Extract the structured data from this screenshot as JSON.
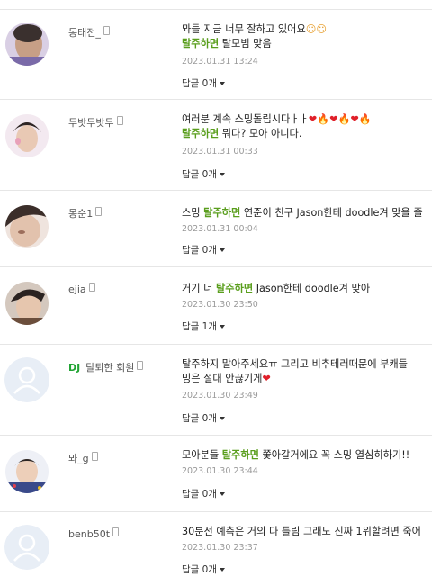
{
  "comments": [
    {
      "nick": "동태전_",
      "line1": "뫄들 지금 너무 잘하고 있어요",
      "emoji1": "☺☺",
      "hl": "탈주하면",
      "line2": "탈모빔 맞음",
      "date": "2023.01.31 13:24",
      "reply": "답글 0개"
    },
    {
      "nick": "두밧두밧두",
      "line1": "여러분 계속 스밍돌립시다ㅏㅏ",
      "emoji1": "❤🔥❤🔥❤🔥",
      "hl": "탈주하면",
      "line2": "뭐다? 모아 아니다.",
      "date": "2023.01.31 00:33",
      "reply": "답글 0개"
    },
    {
      "nick": "몽순1",
      "pre": "스밍 ",
      "hl": "탈주하면",
      "post": " 연준이 친구 Jason한테 doodle겨 맞을 줄",
      "date": "2023.01.31 00:04",
      "reply": "답글 0개"
    },
    {
      "nick": "ejia",
      "pre": "거기 너 ",
      "hl": "탈주하면",
      "post": " Jason한테 doodle겨 맞아",
      "date": "2023.01.30 23:50",
      "reply": "답글 1개"
    },
    {
      "badge": "DJ",
      "nick": "탈퇴한 회원",
      "line1": "탈주하지 말아주세요ㅠ 그리고 비추테러때문에 부캐들",
      "line2": "밍은 절대 안끊기게",
      "emoji2": "❤",
      "date": "2023.01.30 23:49",
      "reply": "답글 0개"
    },
    {
      "nick": "뫄_g",
      "pre": "모아분들 ",
      "hl": "탈주하면",
      "post": " 쫓아갈거에요 꼭 스밍 열심히하기!!",
      "date": "2023.01.30 23:44",
      "reply": "답글 0개"
    },
    {
      "nick": "benb50t",
      "line1": "30분전 예측은 거의 다 틀림 그래도 진짜 1위할려면 죽어",
      "date": "2023.01.30 23:37",
      "reply": "답글 0개"
    }
  ]
}
